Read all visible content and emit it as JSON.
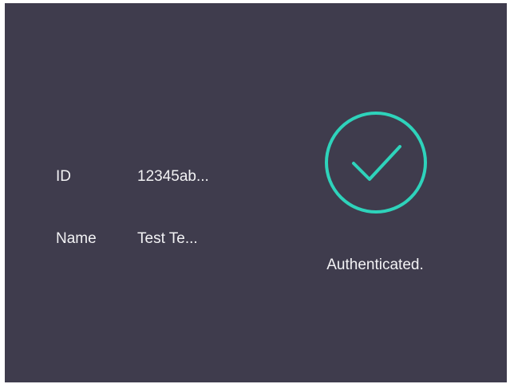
{
  "user_info": {
    "id_label": "ID",
    "id_value": "12345ab...",
    "name_label": "Name",
    "name_value": "Test Te..."
  },
  "status": {
    "icon": "check-circle-icon",
    "text": "Authenticated.",
    "color": "#2ed3bb"
  },
  "theme": {
    "background": "#3f3c4d",
    "text_color": "#f2f2f4"
  }
}
